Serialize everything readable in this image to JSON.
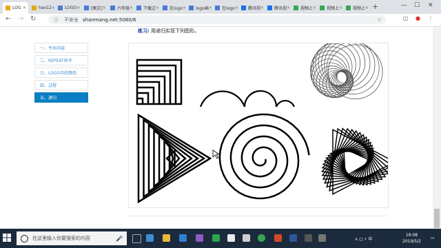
{
  "browser": {
    "tabs": [
      {
        "label": "LOG",
        "active": true
      },
      {
        "label": "hao12"
      },
      {
        "label": "LOGO"
      },
      {
        "label": "[图文]"
      },
      {
        "label": "六年级"
      },
      {
        "label": "下载过"
      },
      {
        "label": "在logo"
      },
      {
        "label": "logo画"
      },
      {
        "label": "在logo"
      },
      {
        "label": "腾讯视"
      },
      {
        "label": "腾讯视"
      },
      {
        "label": "视频上"
      },
      {
        "label": "视频上"
      },
      {
        "label": "视频上"
      }
    ],
    "security_label": "不安全",
    "url": "shanmang.net:5080/6",
    "window_controls": [
      "—",
      "☐",
      "✕"
    ]
  },
  "page": {
    "exercise_label": "练习:",
    "exercise_text": "用递归实现下列图形。",
    "sidebar": [
      {
        "label": "一、今天内容"
      },
      {
        "label": "二、REPEAT命令"
      },
      {
        "label": "三、LOGO中的颜色"
      },
      {
        "label": "四、过程"
      },
      {
        "label": "五、递归",
        "active": true
      }
    ]
  },
  "taskbar": {
    "search_placeholder": "在这里输入你要搜索的内容",
    "tray_text": "∧ ◻ ⚡ 中",
    "time": "19:08",
    "date": "2019/5/2"
  },
  "colors": {
    "accent": "#0a7ec2",
    "taskbar": "#1c2a3d",
    "link": "#3a8fd4"
  }
}
